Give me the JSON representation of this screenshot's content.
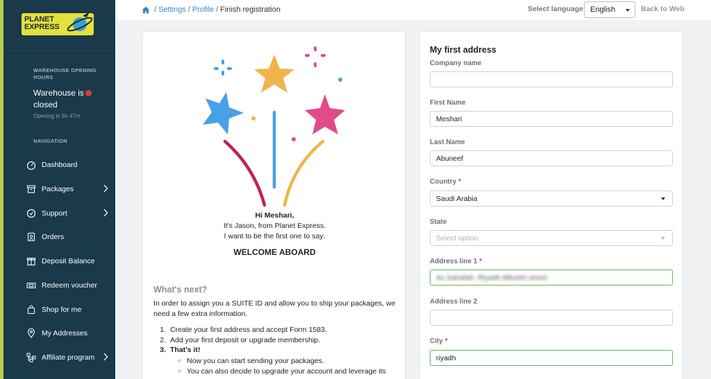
{
  "sidebar": {
    "logo": {
      "line1": "PLANET",
      "line2": "EXPRESS"
    },
    "warehouse_title": "WAREHOUSE OPENING HOURS",
    "warehouse_status": "Warehouse is closed",
    "warehouse_opening": "Opening in 5h 47m",
    "nav_title": "NAVIGATION",
    "items": [
      {
        "label": "Dashboard",
        "icon": "dashboard-icon"
      },
      {
        "label": "Packages",
        "icon": "package-icon"
      },
      {
        "label": "Support",
        "icon": "support-icon"
      },
      {
        "label": "Orders",
        "icon": "orders-icon"
      },
      {
        "label": "Deposit Balance",
        "icon": "deposit-icon"
      },
      {
        "label": "Redeem voucher",
        "icon": "voucher-icon"
      },
      {
        "label": "Shop for me",
        "icon": "shopping-bag-icon"
      },
      {
        "label": "My Addresses",
        "icon": "location-pin-icon"
      },
      {
        "label": "Affiliate program",
        "icon": "affiliate-icon"
      }
    ]
  },
  "topbar": {
    "breadcrumb": {
      "settings": "Settings",
      "profile": "Profile",
      "current": "Finish registration",
      "sep": "/"
    },
    "language_label": "Select language:",
    "language_value": "English",
    "back_to_web": "Back to Web"
  },
  "welcome": {
    "greeting": "Hi Meshari,",
    "line2": "It's Jason, from Planet Express.",
    "line3": "I want to be the first one to say:",
    "headline": "WELCOME ABOARD",
    "whats_next": "What's next?",
    "intro": "In order to assign you a SUITE ID and allow you to ship your packages, we need a few extra information.",
    "steps": [
      {
        "num": "1.",
        "text": "Create your first address and accept Form 1583."
      },
      {
        "num": "2.",
        "text": "Add your first deposit or upgrade membership."
      },
      {
        "num": "3.",
        "text": "That's it!"
      }
    ],
    "substeps": [
      "Now you can start sending your packages.",
      "You can also decide to upgrade your account and leverage its"
    ]
  },
  "address_form": {
    "title": "My first address",
    "company": {
      "label": "Company name",
      "value": ""
    },
    "first_name": {
      "label": "First Name",
      "value": "Meshari"
    },
    "last_name": {
      "label": "Last Name",
      "value": "Abuneef"
    },
    "country": {
      "label": "Country",
      "value": "Saudi Arabia",
      "required": "*"
    },
    "state": {
      "label": "State",
      "placeholder": "Select option"
    },
    "address1": {
      "label": "Address line 1",
      "value": "As Sahafah, Riyadh Albuhtri street",
      "required": "*"
    },
    "address2": {
      "label": "Address line 2",
      "value": ""
    },
    "city": {
      "label": "City",
      "value": "riyadh",
      "required": "*"
    }
  },
  "colors": {
    "sidebar": "#1a3a4b",
    "accent": "#3a88c6",
    "required": "#d9383a",
    "valid": "#5cb85c",
    "logo": "#e3e13a"
  }
}
